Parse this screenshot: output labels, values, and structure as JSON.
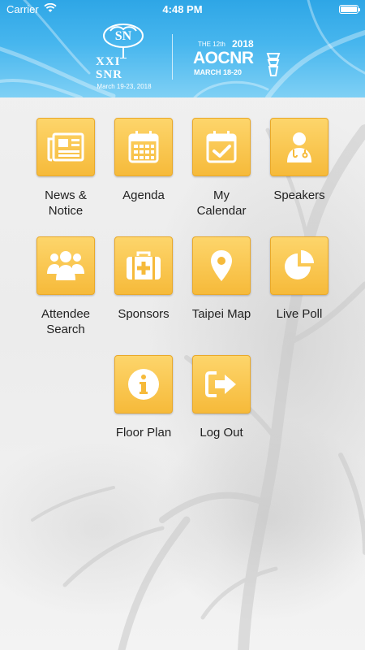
{
  "status_bar": {
    "carrier": "Carrier",
    "time": "4:48 PM",
    "wifi_icon": "wifi-icon",
    "battery_icon": "battery-icon",
    "battery_level": 1.0
  },
  "header": {
    "left_logo": {
      "monogram": "SN",
      "numeral": "XXI",
      "acronym": "SNR",
      "dates": "March 19-23, 2018"
    },
    "right_logo": {
      "edition": "THE 12th",
      "year": "2018",
      "name": "AOCNR",
      "dates": "MARCH 18-20"
    }
  },
  "colors": {
    "header_blue": "#2ea6e6",
    "tile_gold": "#f6ba3a",
    "text": "#222222"
  },
  "menu": [
    {
      "label": "News &\nNotice",
      "icon": "newspaper-icon"
    },
    {
      "label": "Agenda",
      "icon": "calendar-grid-icon"
    },
    {
      "label": "My\nCalendar",
      "icon": "calendar-check-icon"
    },
    {
      "label": "Speakers",
      "icon": "doctor-icon"
    },
    {
      "label": "Attendee\nSearch",
      "icon": "group-icon"
    },
    {
      "label": "Sponsors",
      "icon": "medical-kit-icon"
    },
    {
      "label": "Taipei Map",
      "icon": "map-pin-icon"
    },
    {
      "label": "Live Poll",
      "icon": "pie-chart-icon"
    },
    {
      "label": "Floor Plan",
      "icon": "info-icon"
    },
    {
      "label": "Log Out",
      "icon": "logout-icon"
    }
  ]
}
